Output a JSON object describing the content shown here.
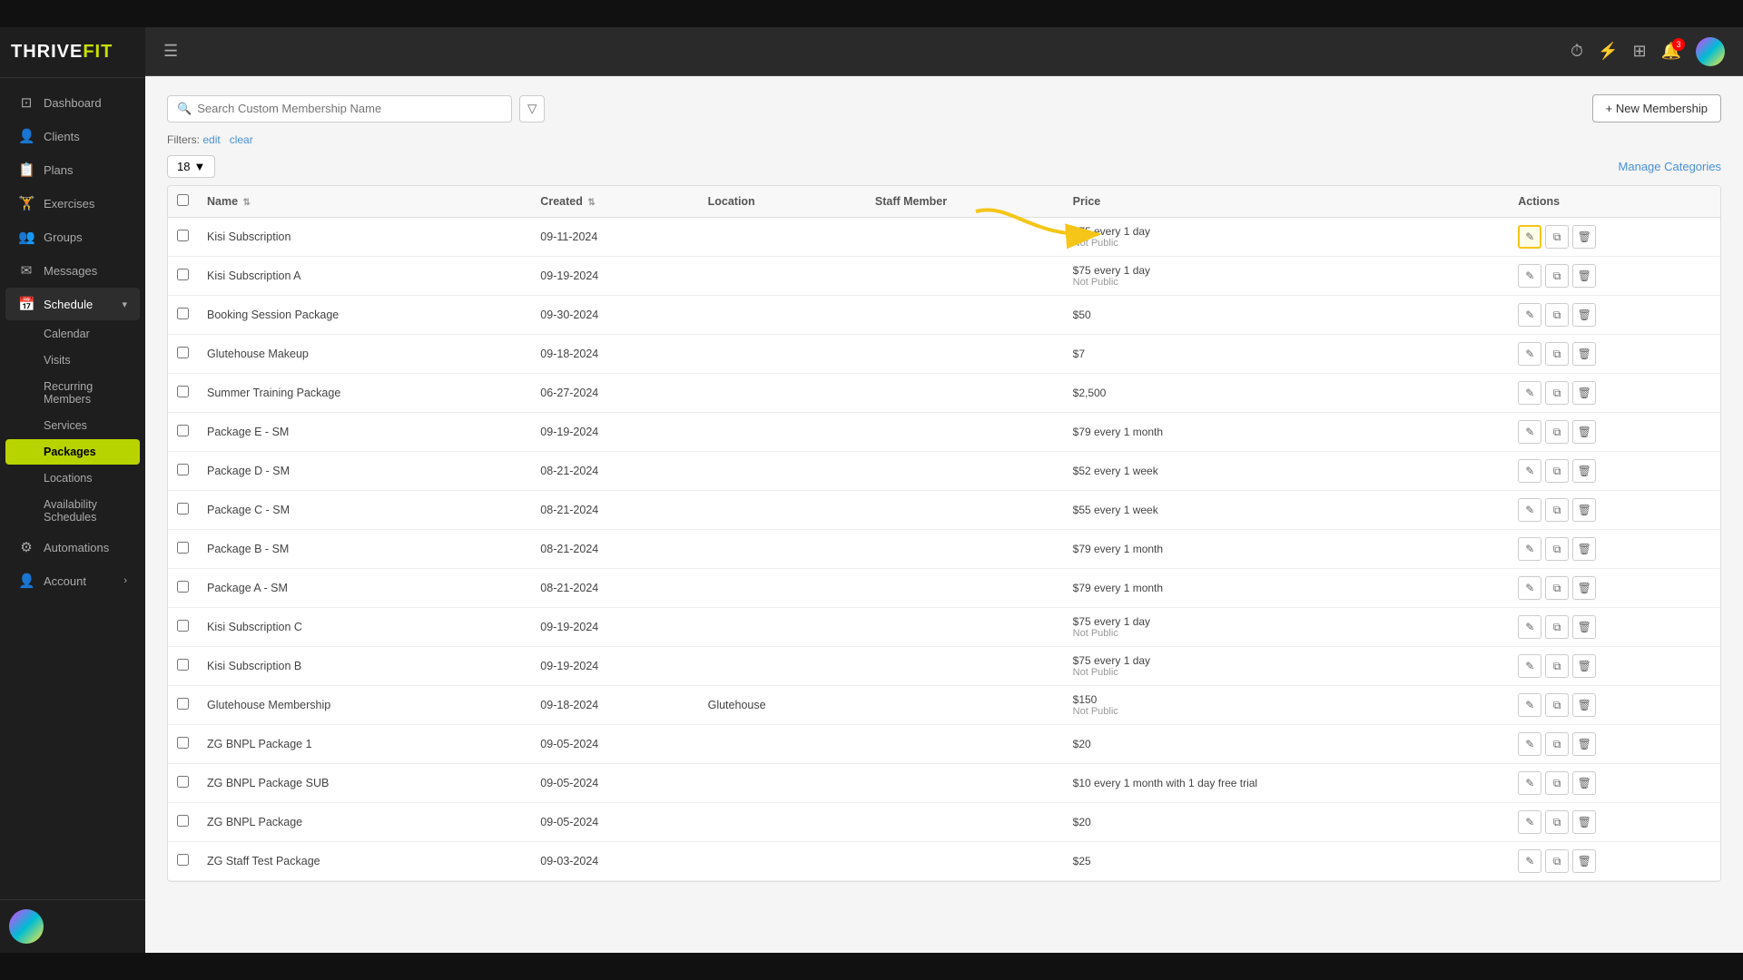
{
  "app": {
    "name": "THRIVEFIT",
    "name_highlight": "FIT"
  },
  "header": {
    "hamburger_label": "☰",
    "icons": [
      "⏱",
      "⚡",
      "⊞",
      "🔔"
    ],
    "notification_count": "3"
  },
  "sidebar": {
    "nav_items": [
      {
        "id": "dashboard",
        "label": "Dashboard",
        "icon": "⊡"
      },
      {
        "id": "clients",
        "label": "Clients",
        "icon": "👤"
      },
      {
        "id": "plans",
        "label": "Plans",
        "icon": "📋"
      },
      {
        "id": "exercises",
        "label": "Exercises",
        "icon": "🏋"
      },
      {
        "id": "groups",
        "label": "Groups",
        "icon": "👥"
      },
      {
        "id": "messages",
        "label": "Messages",
        "icon": "✉"
      },
      {
        "id": "schedule",
        "label": "Schedule",
        "icon": "📅"
      }
    ],
    "schedule_sub_items": [
      {
        "id": "calendar",
        "label": "Calendar"
      },
      {
        "id": "visits",
        "label": "Visits"
      },
      {
        "id": "recurring-members",
        "label": "Recurring Members"
      },
      {
        "id": "services",
        "label": "Services"
      },
      {
        "id": "packages",
        "label": "Packages",
        "active": true
      }
    ],
    "bottom_items": [
      {
        "id": "locations",
        "label": "Locations"
      },
      {
        "id": "availability-schedules",
        "label": "Availability Schedules"
      }
    ],
    "automations": {
      "label": "Automations",
      "icon": "⚙"
    },
    "account": {
      "label": "Account",
      "icon": "👤"
    }
  },
  "toolbar": {
    "search_placeholder": "Search Custom Membership Name",
    "filter_icon": "▽",
    "new_membership_label": "+ New Membership",
    "filters_label": "Filters:",
    "filters_edit": "edit",
    "filters_clear": "clear"
  },
  "table": {
    "count": "18",
    "count_arrow": "▼",
    "manage_categories_label": "Manage Categories",
    "columns": [
      "",
      "Name ⇅",
      "Created ⇅",
      "Location",
      "Staff Member",
      "Price",
      "Actions"
    ],
    "rows": [
      {
        "name": "Kisi Subscription",
        "created": "09-11-2024",
        "location": "",
        "staff": "",
        "price": "$75 every 1 day",
        "not_public": "Not Public",
        "highlight_edit": true
      },
      {
        "name": "Kisi Subscription A",
        "created": "09-19-2024",
        "location": "",
        "staff": "",
        "price": "$75 every 1 day",
        "not_public": "Not Public",
        "highlight_edit": false
      },
      {
        "name": "Booking Session Package",
        "created": "09-30-2024",
        "location": "",
        "staff": "",
        "price": "$50",
        "not_public": "",
        "highlight_edit": false
      },
      {
        "name": "Glutehouse Makeup",
        "created": "09-18-2024",
        "location": "",
        "staff": "",
        "price": "$7",
        "not_public": "",
        "highlight_edit": false
      },
      {
        "name": "Summer Training Package",
        "created": "06-27-2024",
        "location": "",
        "staff": "",
        "price": "$2,500",
        "not_public": "",
        "highlight_edit": false
      },
      {
        "name": "Package E - SM",
        "created": "09-19-2024",
        "location": "",
        "staff": "",
        "price": "$79 every 1 month",
        "not_public": "",
        "highlight_edit": false
      },
      {
        "name": "Package D - SM",
        "created": "08-21-2024",
        "location": "",
        "staff": "",
        "price": "$52 every 1 week",
        "not_public": "",
        "highlight_edit": false
      },
      {
        "name": "Package C - SM",
        "created": "08-21-2024",
        "location": "",
        "staff": "",
        "price": "$55 every 1 week",
        "not_public": "",
        "highlight_edit": false
      },
      {
        "name": "Package B - SM",
        "created": "08-21-2024",
        "location": "",
        "staff": "",
        "price": "$79 every 1 month",
        "not_public": "",
        "highlight_edit": false
      },
      {
        "name": "Package A - SM",
        "created": "08-21-2024",
        "location": "",
        "staff": "",
        "price": "$79 every 1 month",
        "not_public": "",
        "highlight_edit": false
      },
      {
        "name": "Kisi Subscription C",
        "created": "09-19-2024",
        "location": "",
        "staff": "",
        "price": "$75 every 1 day",
        "not_public": "Not Public",
        "highlight_edit": false
      },
      {
        "name": "Kisi Subscription B",
        "created": "09-19-2024",
        "location": "",
        "staff": "",
        "price": "$75 every 1 day",
        "not_public": "Not Public",
        "highlight_edit": false
      },
      {
        "name": "Glutehouse Membership",
        "created": "09-18-2024",
        "location": "Glutehouse",
        "staff": "",
        "price": "$150",
        "not_public": "Not Public",
        "highlight_edit": false
      },
      {
        "name": "ZG BNPL Package 1",
        "created": "09-05-2024",
        "location": "",
        "staff": "",
        "price": "$20",
        "not_public": "",
        "highlight_edit": false
      },
      {
        "name": "ZG BNPL Package SUB",
        "created": "09-05-2024",
        "location": "",
        "staff": "",
        "price": "$10 every 1 month with 1 day free trial",
        "not_public": "",
        "highlight_edit": false
      },
      {
        "name": "ZG BNPL Package",
        "created": "09-05-2024",
        "location": "",
        "staff": "",
        "price": "$20",
        "not_public": "",
        "highlight_edit": false
      },
      {
        "name": "ZG Staff Test Package",
        "created": "09-03-2024",
        "location": "",
        "staff": "",
        "price": "$25",
        "not_public": "",
        "highlight_edit": false
      }
    ]
  },
  "icons": {
    "edit": "✎",
    "copy": "⧉",
    "delete": "🗑",
    "search": "🔍",
    "filter": "▽",
    "chevron": "›"
  }
}
